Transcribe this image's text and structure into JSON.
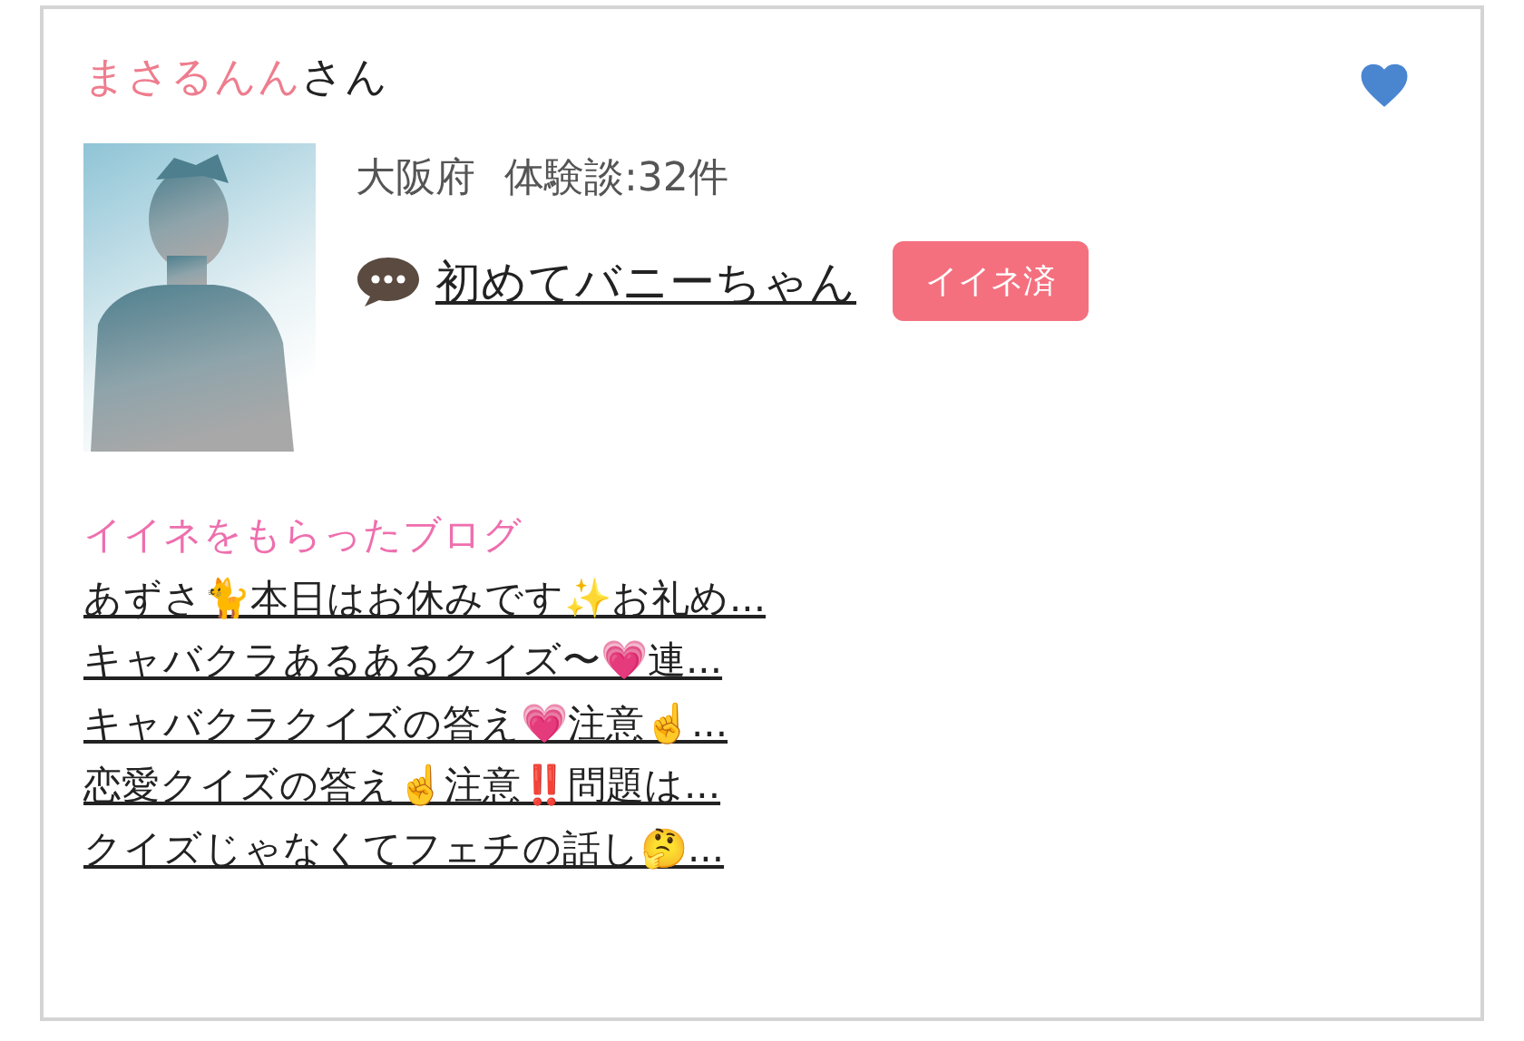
{
  "user": {
    "name": "まさるんん",
    "honorific": "さん",
    "favorited": true
  },
  "profile": {
    "area": "大阪府",
    "reviews": "体験談:32件",
    "blog_title": "初めてバニーちゃん",
    "like_button": {
      "label": "イイネ済",
      "liked": true
    }
  },
  "liked_blogs": {
    "heading": "イイネをもらったブログ",
    "items": [
      "あずさ🐈本日はお休みです✨お礼め...",
      "キャバクラあるあるクイズ〜💗連...",
      "キャバクラクイズの答え💗注意☝️...",
      "恋愛クイズの答え☝️注意‼️問題は...",
      "クイズじゃなくてフェチの話し🤔..."
    ]
  }
}
